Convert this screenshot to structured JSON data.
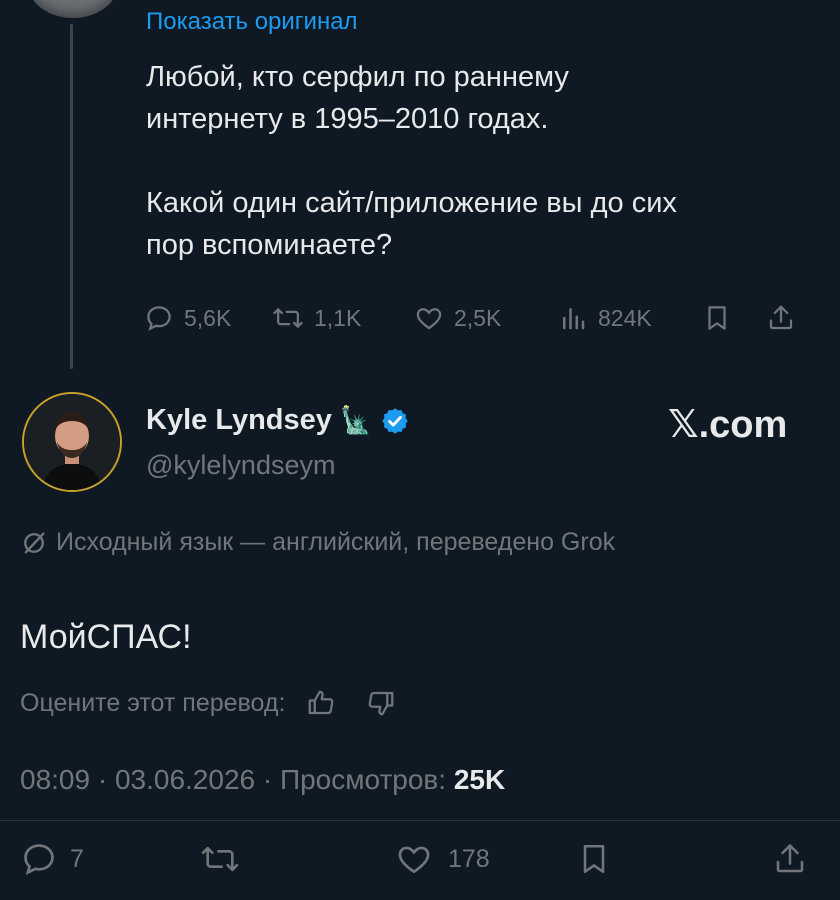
{
  "parent_tweet": {
    "show_original": "Показать оригинал",
    "text": "Любой, кто серфил по раннему\nинтернету в 1995–2010 годах.\n\nКакой один сайт/приложение вы до сих\nпор вспоминаете?",
    "actions": {
      "replies": "5,6K",
      "reposts": "1,1K",
      "likes": "2,5K",
      "views": "824K"
    }
  },
  "tweet": {
    "author_name": "Kyle Lyndsey",
    "author_handle": "@kylelyndseym",
    "name_emoji": "🗽",
    "brand": "𝕏.com",
    "translation_note": "Исходный язык — английский, переведено Grok",
    "text": "МойСПАС!",
    "rate_prompt": "Оцените этот перевод:",
    "time": "08:09 · 03.06.2026 · Просмотров: ",
    "views": "25K",
    "actions": {
      "replies": "7",
      "likes": "178"
    }
  },
  "icons": {
    "reply": "reply-icon",
    "repost": "repost-icon",
    "like": "heart-icon",
    "views": "views-chart-icon",
    "bookmark": "bookmark-icon",
    "share": "share-icon",
    "verified": "verified-badge-icon",
    "thumbs_up": "thumbs-up-icon",
    "thumbs_down": "thumbs-down-icon",
    "translate": "translate-icon"
  },
  "colors": {
    "background": "#0f1923",
    "link": "#1d9bf0",
    "muted": "#71767b",
    "verified": "#1d9bf0"
  }
}
